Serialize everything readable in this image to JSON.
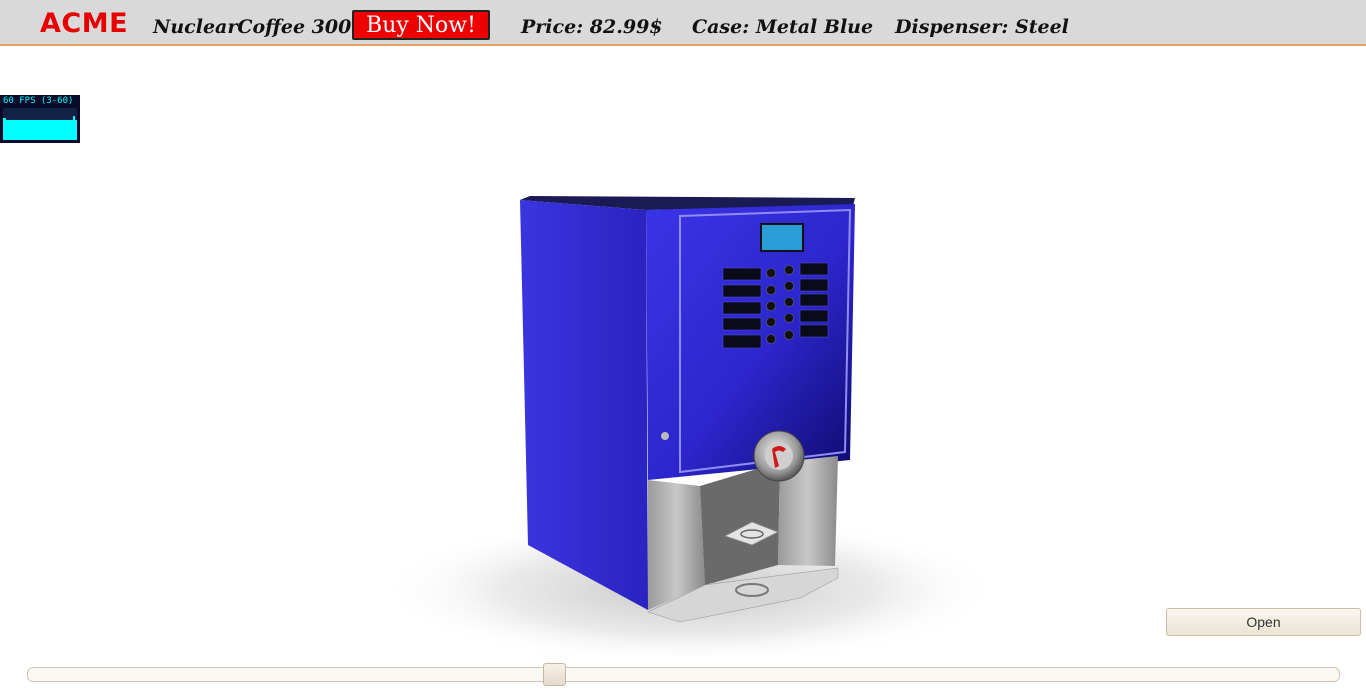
{
  "header": {
    "logo": "ACME",
    "product_name": "NuclearCoffee 3000",
    "buy_label": "Buy Now!",
    "price": "Price: 82.99$",
    "case": "Case: Metal Blue",
    "dispenser": "Dispenser: Steel"
  },
  "fps_meter": {
    "label": "60 FPS (3-60)"
  },
  "viewer": {
    "open_label": "Open",
    "slider_value_fraction": 0.4
  },
  "colors": {
    "brand_red": "#e60000",
    "buy_button": "#ee0000",
    "case_blue": "#2f2ad6",
    "fps_cyan": "#00ffff"
  }
}
